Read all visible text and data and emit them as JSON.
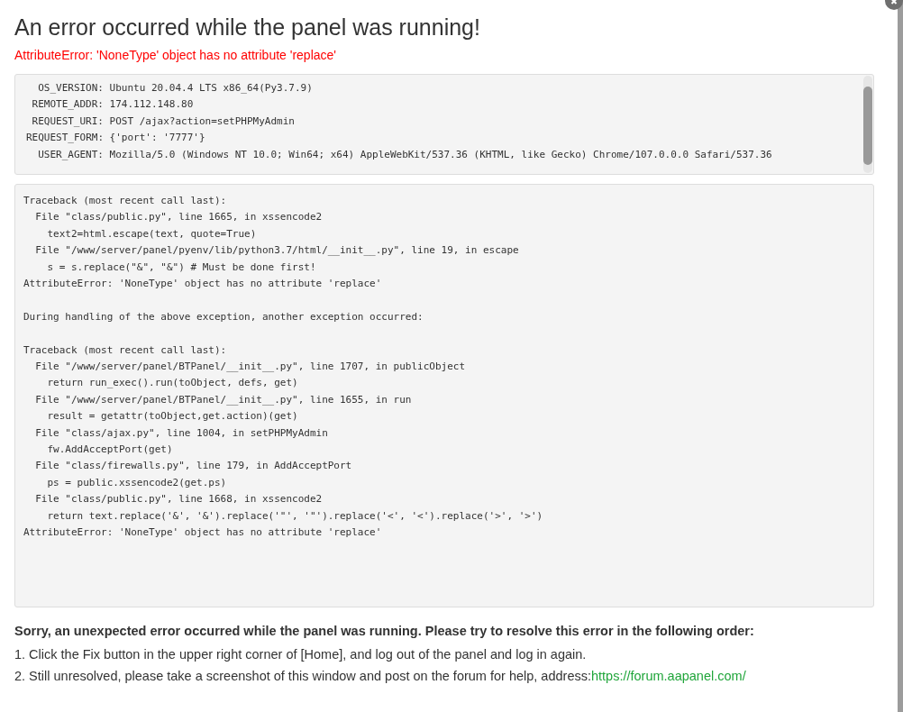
{
  "dialog": {
    "title": "An error occurred while the panel was running!",
    "error_message": "AttributeError: 'NoneType' object has no attribute 'replace'"
  },
  "environment": [
    {
      "label": "OS_VERSION:",
      "value": "Ubuntu 20.04.4 LTS x86_64(Py3.7.9)"
    },
    {
      "label": "REMOTE_ADDR:",
      "value": "174.112.148.80"
    },
    {
      "label": "REQUEST_URI:",
      "value": "POST /ajax?action=setPHPMyAdmin"
    },
    {
      "label": "REQUEST_FORM:",
      "value": "{'port': '7777'}"
    },
    {
      "label": "USER_AGENT:",
      "value": "Mozilla/5.0 (Windows NT 10.0; Win64; x64) AppleWebKit/537.36 (KHTML, like Gecko) Chrome/107.0.0.0 Safari/537.36"
    }
  ],
  "traceback": [
    [
      "Traceback (most recent call last):",
      "  File \"class/public.py\", line 1665, in xssencode2",
      "    text2=html.escape(text, quote=True)",
      "  File \"/www/server/panel/pyenv/lib/python3.7/html/__init__.py\", line 19, in escape",
      "    s = s.replace(\"&\", \"&\") # Must be done first!",
      "AttributeError: 'NoneType' object has no attribute 'replace'"
    ],
    [
      "During handling of the above exception, another exception occurred:"
    ],
    [
      "Traceback (most recent call last):",
      "  File \"/www/server/panel/BTPanel/__init__.py\", line 1707, in publicObject",
      "    return run_exec().run(toObject, defs, get)",
      "  File \"/www/server/panel/BTPanel/__init__.py\", line 1655, in run",
      "    result = getattr(toObject,get.action)(get)",
      "  File \"class/ajax.py\", line 1004, in setPHPMyAdmin",
      "    fw.AddAcceptPort(get)",
      "  File \"class/firewalls.py\", line 179, in AddAcceptPort",
      "    ps = public.xssencode2(get.ps)",
      "  File \"class/public.py\", line 1668, in xssencode2",
      "    return text.replace('&', '&').replace('\"', '\"').replace('<', '<').replace('>', '>')",
      "AttributeError: 'NoneType' object has no attribute 'replace'"
    ]
  ],
  "help": {
    "intro": "Sorry, an unexpected error occurred while the panel was running. Please try to resolve this error in the following order:",
    "steps": [
      {
        "text": "1. Click the Fix button in the upper right corner of [Home], and log out of the panel and log in again."
      },
      {
        "text": "2. Still unresolved, please take a screenshot of this window and post on the forum for help, address:",
        "link": "https://forum.aapanel.com/"
      }
    ]
  }
}
